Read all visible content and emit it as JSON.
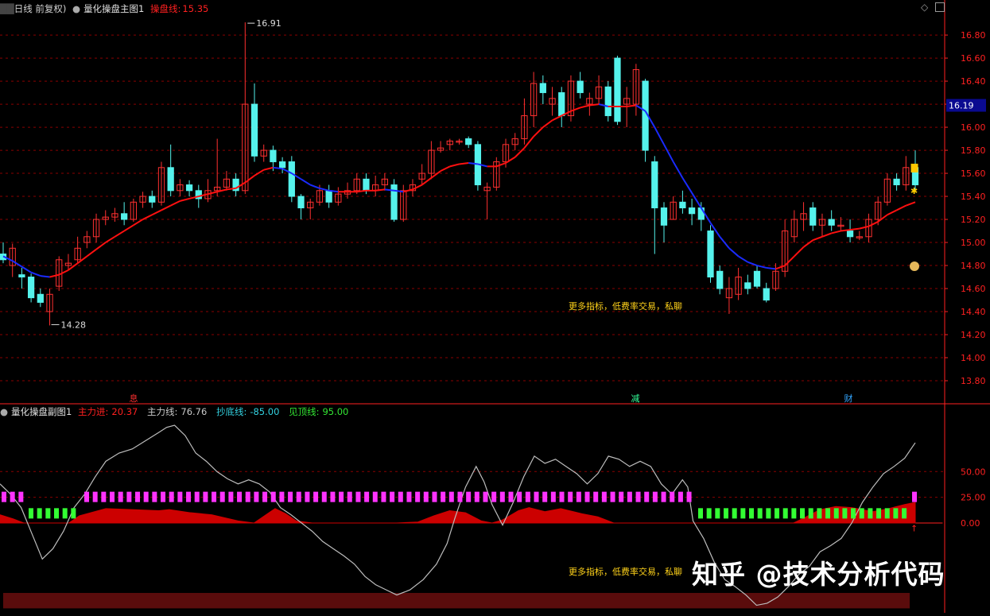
{
  "main_header": {
    "period": "日线 前复权)",
    "indicator": "量化操盘主图1",
    "line_label": "操盘线:",
    "line_value": "15.35"
  },
  "sub_header": {
    "indicator": "量化操盘副图1",
    "items": [
      {
        "label": "主力进:",
        "value": "20.37",
        "color": "#ff2020"
      },
      {
        "label": "主力线:",
        "value": "76.76",
        "color": "#c8c8c8"
      },
      {
        "label": "抄底线:",
        "value": "-85.00",
        "color": "#33d1e0"
      },
      {
        "label": "见顶线:",
        "value": "95.00",
        "color": "#33e633"
      }
    ]
  },
  "markers": {
    "high": "16.91",
    "low": "14.28",
    "price_tag": "16.19"
  },
  "event_labels": [
    {
      "text": "息",
      "color": "#ff3030",
      "x_index": 26
    },
    {
      "text": "减",
      "color": "#33ff99",
      "x_index": 132
    },
    {
      "text": "财",
      "color": "#33a6ff",
      "x_index": 178
    }
  ],
  "ad_text": "更多指标，低费率交易，私聊",
  "watermark": "知乎 @技术分析代码",
  "colors": {
    "up": "#ff3030",
    "down": "#55f2ec",
    "ma_up": "#ff1010",
    "ma_down": "#1a2bff",
    "grid": "#8a0000",
    "axis": "#ff2020",
    "magenta": "#ff33ff",
    "green": "#33ff33"
  },
  "chart_data": [
    {
      "type": "candlestick",
      "name": "main",
      "ylim": [
        13.6,
        16.98
      ],
      "y_ticks": [
        13.8,
        14.0,
        14.2,
        14.4,
        14.6,
        14.8,
        15.0,
        15.2,
        15.4,
        15.6,
        15.8,
        16.0,
        16.2,
        16.4,
        16.6,
        16.8
      ],
      "candles": [
        [
          14.9,
          14.85,
          15.0,
          14.82
        ],
        [
          14.8,
          14.95,
          14.99,
          14.7
        ],
        [
          14.72,
          14.7,
          14.78,
          14.6
        ],
        [
          14.7,
          14.52,
          14.73,
          14.48
        ],
        [
          14.55,
          14.48,
          14.6,
          14.44
        ],
        [
          14.4,
          14.55,
          14.6,
          14.28
        ],
        [
          14.62,
          14.85,
          14.88,
          14.58
        ],
        [
          14.8,
          14.82,
          14.9,
          14.76
        ],
        [
          14.85,
          14.95,
          15.05,
          14.82
        ],
        [
          15.0,
          15.05,
          15.1,
          14.95
        ],
        [
          15.05,
          15.2,
          15.25,
          15.0
        ],
        [
          15.2,
          15.22,
          15.28,
          15.15
        ],
        [
          15.22,
          15.25,
          15.3,
          15.18
        ],
        [
          15.25,
          15.2,
          15.35,
          15.15
        ],
        [
          15.2,
          15.35,
          15.38,
          15.18
        ],
        [
          15.35,
          15.4,
          15.44,
          15.3
        ],
        [
          15.4,
          15.35,
          15.45,
          15.3
        ],
        [
          15.35,
          15.65,
          15.7,
          15.32
        ],
        [
          15.65,
          15.45,
          15.85,
          15.4
        ],
        [
          15.45,
          15.5,
          15.55,
          15.4
        ],
        [
          15.5,
          15.45,
          15.54,
          15.4
        ],
        [
          15.45,
          15.38,
          15.5,
          15.3
        ],
        [
          15.38,
          15.45,
          15.55,
          15.35
        ],
        [
          15.45,
          15.48,
          15.9,
          15.4
        ],
        [
          15.48,
          15.55,
          15.62,
          15.45
        ],
        [
          15.55,
          15.45,
          15.6,
          15.4
        ],
        [
          15.45,
          16.2,
          16.91,
          15.42
        ],
        [
          16.2,
          15.75,
          16.38,
          15.7
        ],
        [
          15.75,
          15.8,
          15.85,
          15.7
        ],
        [
          15.8,
          15.7,
          15.84,
          15.62
        ],
        [
          15.7,
          15.65,
          15.74,
          15.6
        ],
        [
          15.7,
          15.4,
          15.75,
          15.35
        ],
        [
          15.4,
          15.3,
          15.42,
          15.2
        ],
        [
          15.3,
          15.35,
          15.38,
          15.2
        ],
        [
          15.35,
          15.45,
          15.5,
          15.32
        ],
        [
          15.45,
          15.35,
          15.5,
          15.3
        ],
        [
          15.35,
          15.42,
          15.48,
          15.32
        ],
        [
          15.42,
          15.45,
          15.52,
          15.38
        ],
        [
          15.45,
          15.55,
          15.6,
          15.42
        ],
        [
          15.55,
          15.45,
          15.6,
          15.42
        ],
        [
          15.45,
          15.5,
          15.58,
          15.4
        ],
        [
          15.5,
          15.55,
          15.6,
          15.45
        ],
        [
          15.5,
          15.2,
          15.55,
          15.18
        ],
        [
          15.2,
          15.45,
          15.5,
          15.18
        ],
        [
          15.45,
          15.5,
          15.55,
          15.4
        ],
        [
          15.55,
          15.6,
          15.68,
          15.5
        ],
        [
          15.6,
          15.8,
          15.88,
          15.55
        ],
        [
          15.8,
          15.82,
          15.88,
          15.78
        ],
        [
          15.85,
          15.88,
          15.9,
          15.8
        ],
        [
          15.88,
          15.88,
          15.9,
          15.85
        ],
        [
          15.9,
          15.85,
          15.92,
          15.82
        ],
        [
          15.85,
          15.5,
          15.88,
          15.45
        ],
        [
          15.45,
          15.48,
          15.52,
          15.2
        ],
        [
          15.48,
          15.7,
          15.74,
          15.45
        ],
        [
          15.7,
          15.85,
          15.9,
          15.65
        ],
        [
          15.85,
          15.9,
          15.95,
          15.8
        ],
        [
          15.9,
          16.1,
          16.25,
          15.85
        ],
        [
          16.1,
          16.38,
          16.48,
          16.0
        ],
        [
          16.38,
          16.3,
          16.45,
          16.2
        ],
        [
          16.2,
          16.25,
          16.35,
          16.1
        ],
        [
          16.3,
          16.1,
          16.35,
          16.0
        ],
        [
          16.1,
          16.4,
          16.45,
          16.05
        ],
        [
          16.4,
          16.3,
          16.48,
          16.25
        ],
        [
          16.2,
          16.25,
          16.3,
          16.1
        ],
        [
          16.25,
          16.35,
          16.45,
          16.2
        ],
        [
          16.35,
          16.1,
          16.4,
          16.05
        ],
        [
          16.6,
          16.05,
          16.62,
          16.02
        ],
        [
          16.2,
          16.25,
          16.35,
          16.0
        ],
        [
          16.2,
          16.5,
          16.55,
          16.1
        ],
        [
          16.4,
          15.8,
          16.42,
          15.7
        ],
        [
          15.7,
          15.3,
          15.75,
          14.9
        ],
        [
          15.3,
          15.15,
          15.35,
          15.0
        ],
        [
          15.2,
          15.35,
          15.4,
          15.2
        ],
        [
          15.35,
          15.3,
          15.45,
          15.25
        ],
        [
          15.3,
          15.25,
          15.38,
          15.15
        ],
        [
          15.3,
          15.2,
          15.35,
          15.1
        ],
        [
          15.1,
          14.7,
          15.15,
          14.65
        ],
        [
          14.75,
          14.6,
          14.8,
          14.55
        ],
        [
          14.52,
          14.6,
          14.7,
          14.38
        ],
        [
          14.55,
          14.7,
          14.78,
          14.5
        ],
        [
          14.65,
          14.6,
          14.72,
          14.55
        ],
        [
          14.75,
          14.62,
          14.8,
          14.6
        ],
        [
          14.6,
          14.5,
          14.65,
          14.48
        ],
        [
          14.6,
          14.75,
          14.82,
          14.58
        ],
        [
          14.75,
          15.1,
          15.2,
          14.7
        ],
        [
          15.05,
          15.2,
          15.28,
          15.0
        ],
        [
          15.2,
          15.25,
          15.35,
          15.1
        ],
        [
          15.3,
          15.15,
          15.35,
          15.1
        ],
        [
          15.15,
          15.2,
          15.25,
          15.05
        ],
        [
          15.2,
          15.15,
          15.28,
          15.1
        ],
        [
          15.15,
          15.15,
          15.22,
          15.1
        ],
        [
          15.1,
          15.05,
          15.2,
          15.0
        ],
        [
          15.05,
          15.05,
          15.1,
          15.02
        ],
        [
          15.05,
          15.2,
          15.25,
          15.0
        ],
        [
          15.2,
          15.35,
          15.4,
          15.15
        ],
        [
          15.35,
          15.55,
          15.6,
          15.32
        ],
        [
          15.55,
          15.5,
          15.6,
          15.45
        ],
        [
          15.5,
          15.65,
          15.75,
          15.45
        ],
        [
          15.65,
          15.5,
          15.8,
          15.45
        ]
      ],
      "ma_line": [
        14.88,
        14.84,
        14.79,
        14.74,
        14.71,
        14.7,
        14.72,
        14.76,
        14.82,
        14.88,
        14.94,
        15.0,
        15.05,
        15.1,
        15.15,
        15.2,
        15.24,
        15.28,
        15.32,
        15.36,
        15.38,
        15.4,
        15.42,
        15.44,
        15.46,
        15.47,
        15.52,
        15.58,
        15.63,
        15.65,
        15.64,
        15.6,
        15.55,
        15.5,
        15.47,
        15.45,
        15.44,
        15.44,
        15.44,
        15.45,
        15.45,
        15.46,
        15.45,
        15.44,
        15.46,
        15.5,
        15.56,
        15.62,
        15.66,
        15.68,
        15.69,
        15.68,
        15.66,
        15.66,
        15.69,
        15.74,
        15.82,
        15.92,
        16.0,
        16.06,
        16.1,
        16.14,
        16.17,
        16.19,
        16.2,
        16.18,
        16.18,
        16.18,
        16.19,
        16.14,
        16.0,
        15.85,
        15.7,
        15.56,
        15.43,
        15.3,
        15.17,
        15.05,
        14.95,
        14.88,
        14.83,
        14.8,
        14.78,
        14.77,
        14.8,
        14.88,
        14.96,
        15.02,
        15.05,
        15.08,
        15.1,
        15.11,
        15.12,
        15.14,
        15.18,
        15.24,
        15.28,
        15.32,
        15.35
      ]
    },
    {
      "type": "indicator",
      "name": "sub",
      "ylim": [
        -85,
        102
      ],
      "y_ticks": [
        0.0,
        25.0,
        50.0
      ],
      "main_line_pts": [
        [
          0,
          38
        ],
        [
          4,
          28
        ],
        [
          8,
          15
        ],
        [
          12,
          -10
        ],
        [
          16,
          -35
        ],
        [
          20,
          -25
        ],
        [
          24,
          -8
        ],
        [
          28,
          15
        ],
        [
          32,
          28
        ],
        [
          36,
          45
        ],
        [
          40,
          60
        ],
        [
          45,
          68
        ],
        [
          50,
          72
        ],
        [
          55,
          80
        ],
        [
          60,
          88
        ],
        [
          63,
          93
        ],
        [
          66,
          95
        ],
        [
          70,
          85
        ],
        [
          74,
          68
        ],
        [
          78,
          60
        ],
        [
          82,
          50
        ],
        [
          86,
          43
        ],
        [
          90,
          38
        ],
        [
          94,
          42
        ],
        [
          98,
          38
        ],
        [
          102,
          30
        ],
        [
          106,
          15
        ],
        [
          110,
          8
        ],
        [
          114,
          0
        ],
        [
          118,
          -8
        ],
        [
          122,
          -18
        ],
        [
          126,
          -25
        ],
        [
          130,
          -32
        ],
        [
          134,
          -40
        ],
        [
          138,
          -52
        ],
        [
          142,
          -60
        ],
        [
          146,
          -65
        ],
        [
          150,
          -70
        ],
        [
          155,
          -65
        ],
        [
          160,
          -55
        ],
        [
          165,
          -40
        ],
        [
          169,
          -20
        ],
        [
          172,
          5
        ],
        [
          176,
          35
        ],
        [
          180,
          55
        ],
        [
          183,
          40
        ],
        [
          186,
          18
        ],
        [
          190,
          -2
        ],
        [
          194,
          20
        ],
        [
          198,
          45
        ],
        [
          202,
          65
        ],
        [
          206,
          58
        ],
        [
          210,
          62
        ],
        [
          214,
          55
        ],
        [
          218,
          48
        ],
        [
          222,
          38
        ],
        [
          226,
          48
        ],
        [
          230,
          65
        ],
        [
          234,
          62
        ],
        [
          238,
          55
        ],
        [
          242,
          60
        ],
        [
          246,
          55
        ],
        [
          250,
          38
        ],
        [
          254,
          28
        ],
        [
          258,
          42
        ],
        [
          260,
          35
        ],
        [
          262,
          2
        ],
        [
          266,
          -15
        ],
        [
          270,
          -38
        ],
        [
          274,
          -55
        ],
        [
          278,
          -62
        ],
        [
          282,
          -70
        ],
        [
          286,
          -80
        ],
        [
          290,
          -78
        ],
        [
          294,
          -72
        ],
        [
          298,
          -62
        ],
        [
          302,
          -50
        ],
        [
          306,
          -42
        ],
        [
          310,
          -28
        ],
        [
          314,
          -22
        ],
        [
          318,
          -15
        ],
        [
          322,
          0
        ],
        [
          326,
          20
        ],
        [
          330,
          35
        ],
        [
          334,
          48
        ],
        [
          338,
          55
        ],
        [
          342,
          63
        ],
        [
          346,
          78
        ]
      ],
      "area_pts": [
        [
          0,
          8
        ],
        [
          5,
          4
        ],
        [
          9,
          0
        ],
        [
          15,
          0
        ],
        [
          26,
          0
        ],
        [
          30,
          7
        ],
        [
          40,
          14
        ],
        [
          50,
          13
        ],
        [
          60,
          12
        ],
        [
          64,
          13
        ],
        [
          72,
          10
        ],
        [
          80,
          8
        ],
        [
          90,
          2
        ],
        [
          96,
          0
        ],
        [
          100,
          7
        ],
        [
          104,
          14
        ],
        [
          108,
          9
        ],
        [
          112,
          2
        ],
        [
          118,
          0
        ],
        [
          150,
          0
        ],
        [
          158,
          1
        ],
        [
          164,
          7
        ],
        [
          170,
          12
        ],
        [
          176,
          10
        ],
        [
          182,
          2
        ],
        [
          186,
          0
        ],
        [
          190,
          3
        ],
        [
          196,
          12
        ],
        [
          200,
          15
        ],
        [
          206,
          11
        ],
        [
          212,
          14
        ],
        [
          220,
          9
        ],
        [
          226,
          6
        ],
        [
          232,
          0
        ],
        [
          250,
          0
        ],
        [
          282,
          0
        ],
        [
          290,
          0
        ],
        [
          300,
          0
        ],
        [
          304,
          5
        ],
        [
          310,
          13
        ],
        [
          316,
          16
        ],
        [
          322,
          15
        ],
        [
          330,
          11
        ],
        [
          336,
          14
        ],
        [
          342,
          18
        ],
        [
          346,
          20
        ]
      ],
      "bottom_band": [
        -68,
        -83
      ]
    }
  ]
}
